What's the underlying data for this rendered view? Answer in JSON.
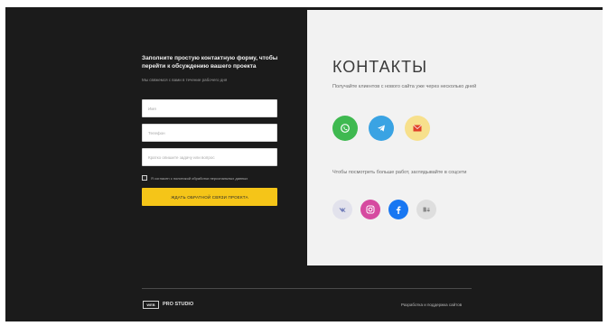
{
  "form": {
    "title": "Заполните простую контактную форму, чтобы перейти к обсуждению вашего проекта",
    "subtitle": "Мы свяжемся с вами в течение рабочего дня",
    "fields": [
      {
        "placeholder": "Имя"
      },
      {
        "placeholder": "Телефон"
      },
      {
        "placeholder": "Кратко опишите задачу или вопрос"
      }
    ],
    "consent_label": "Я согласен с политикой обработки персональных данных",
    "submit_label": "ЖДАТЬ ОБРАТНОЙ СВЯЗИ ПРОЕКТА"
  },
  "contacts": {
    "title": "КОНТАКТЫ",
    "messengers_text": "Получайте клиентов с нового сайта уже через несколько дней",
    "socials_text": "Чтобы посмотреть больше работ, заглядывайте в соцсети",
    "messengers": [
      {
        "icon": "whatsapp-icon",
        "color": "#3fb950"
      },
      {
        "icon": "telegram-icon",
        "color": "#3aa3e3"
      },
      {
        "icon": "email-icon",
        "color": "#f7e08c"
      }
    ],
    "socials": [
      {
        "icon": "vk-icon",
        "color": "#e2e2ec"
      },
      {
        "icon": "instagram-icon",
        "color": "#d64aa0"
      },
      {
        "icon": "facebook-icon",
        "color": "#1877f2"
      },
      {
        "icon": "behance-icon",
        "color": "#dedede"
      }
    ]
  },
  "footer": {
    "logo_text": "WEB",
    "brand": "PRO STUDIO",
    "link": "Разработка и поддержка сайтов"
  }
}
